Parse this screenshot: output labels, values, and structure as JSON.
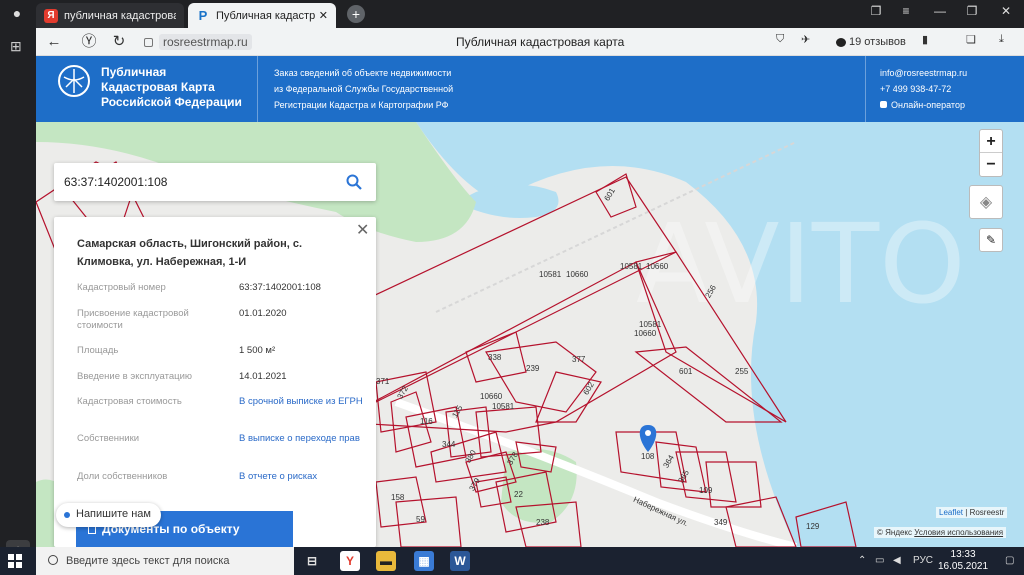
{
  "browser": {
    "tabs": [
      {
        "label": "публичная кадастровая к",
        "favicon": "Я"
      },
      {
        "label": "Публичная кадастровая",
        "favicon": "Р"
      }
    ],
    "url_domain": "rosreestrmap.ru",
    "page_title": "Публичная кадастровая карта",
    "reviews": "19 отзывов"
  },
  "header": {
    "logo_lines": [
      "Публичная",
      "Кадастровая Карта",
      "Российской Федерации"
    ],
    "middle_lines": [
      "Заказ сведений об объекте недвижимости",
      "из Федеральной Службы Государственной",
      "Регистрации Кадастра и Картографии РФ"
    ],
    "email": "info@rosreestrmap.ru",
    "phone": "+7 499 938-47-72",
    "online": "Онлайн-оператор"
  },
  "search": {
    "value": "63:37:1402001:108"
  },
  "info": {
    "address": "Самарская область, Шигонский район, с. Климовка, ул. Набережная, 1-И",
    "rows": [
      {
        "label": "Кадастровый номер",
        "value": "63:37:1402001:108"
      },
      {
        "label": "Присвоение кадастровой стоимости",
        "value": "01.01.2020"
      },
      {
        "label": "Площадь",
        "value": "1 500 м²"
      },
      {
        "label": "Введение в эксплуатацию",
        "value": "14.01.2021"
      },
      {
        "label": "Кадастровая стоимость",
        "value": "В срочной выписке из ЕГРН"
      },
      {
        "label": "Собственники",
        "value": "В выписке о переходе прав"
      },
      {
        "label": "Доли собственников",
        "value": "В отчете о рисках"
      }
    ],
    "doc_button": "Документы по объекту",
    "chat": "Напишите нам"
  },
  "map": {
    "parcels": [
      "601",
      "10581",
      "10660",
      "10581",
      "10660",
      "256",
      "10581",
      "10660",
      "338",
      "377",
      "239",
      "602",
      "601",
      "255",
      "371",
      "372",
      "116",
      "115",
      "10660",
      "10581",
      "344",
      "380",
      "378",
      "108",
      "364",
      "365",
      "109",
      "379",
      "22",
      "158",
      "59",
      "238",
      "349",
      "129"
    ],
    "street": "Набережная ул.",
    "attribution_leaflet": "Leaflet",
    "attribution_rosreestr": "Rosreestr",
    "attribution_yandex": "© Яндекс",
    "terms": "Условия использования"
  },
  "taskbar": {
    "search_placeholder": "Введите здесь текст для поиска",
    "lang": "РУС",
    "time": "13:33",
    "date": "16.05.2021"
  },
  "colors": {
    "header_blue": "#1e6ec8",
    "button_blue": "#2a74d6",
    "water": "#b3dff2",
    "forest": "#c4e6c2",
    "parcel": "#b5122d"
  }
}
